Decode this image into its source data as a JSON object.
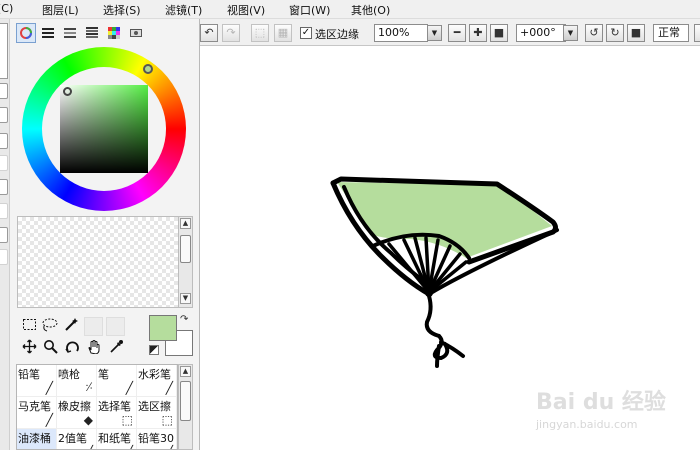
{
  "menu": {
    "items": [
      "(C)",
      "图层(L)",
      "选择(S)",
      "滤镜(T)",
      "视图(V)",
      "窗口(W)",
      "其他(O)"
    ]
  },
  "canvas_toolbar": {
    "undo_icon": "undo-icon",
    "redo_icon": "redo-icon",
    "show_selection_label": "选区边缘",
    "show_selection_checked": true,
    "zoom_value": "100%",
    "rotation_value": "+000°",
    "mode_label": "正常"
  },
  "tool_icons": [
    "rect-select-icon",
    "lasso-icon",
    "magic-wand-icon",
    "move-icon",
    "zoom-icon",
    "rotate-icon",
    "hand-icon",
    "eyedropper-icon"
  ],
  "colors": {
    "foreground": "#b5dd9d",
    "background": "#ffffff",
    "fan_fill": "#b5dd9d",
    "fan_outline": "#000000"
  },
  "brushes": [
    {
      "label": "铅笔",
      "icon": "pencil-icon"
    },
    {
      "label": "喷枪",
      "icon": "airbrush-icon"
    },
    {
      "label": "笔",
      "icon": "pen-icon"
    },
    {
      "label": "水彩笔",
      "icon": "watercolor-icon"
    },
    {
      "label": "马克笔",
      "icon": "marker-icon"
    },
    {
      "label": "橡皮擦",
      "icon": "eraser-icon"
    },
    {
      "label": "选择笔",
      "icon": "select-pen-icon"
    },
    {
      "label": "选区擦",
      "icon": "select-eraser-icon"
    },
    {
      "label": "油漆桶",
      "icon": "bucket-icon",
      "selected": true
    },
    {
      "label": "2值笔",
      "icon": "binary-pen-icon"
    },
    {
      "label": "和纸笔",
      "icon": "washi-pen-icon"
    },
    {
      "label": "铅笔30",
      "icon": "pencil30-icon"
    }
  ],
  "watermark": {
    "text": "Bai du 经验",
    "sub": "jingyan.baidu.com"
  }
}
